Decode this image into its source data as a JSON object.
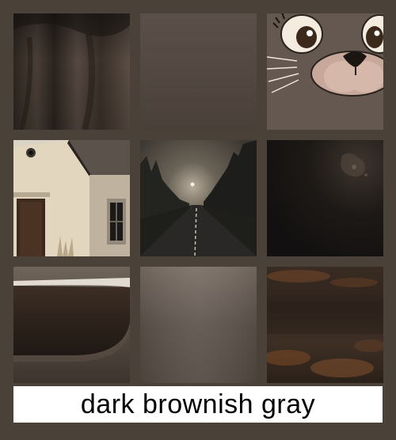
{
  "caption": "dark brownish gray",
  "colors": {
    "background": "#4a4139",
    "caption_background": "#ffffff",
    "caption_text": "#000000"
  },
  "tiles": [
    {
      "name": "dark draped fabric"
    },
    {
      "name": "plain dark brownish gray gradient"
    },
    {
      "name": "cartoon cat face"
    },
    {
      "name": "old house with wooden door"
    },
    {
      "name": "foggy road through dark forest"
    },
    {
      "name": "dark textured wall"
    },
    {
      "name": "dark coffee cup close-up"
    },
    {
      "name": "smooth gray-brown gradient"
    },
    {
      "name": "dark rusty brown texture"
    }
  ]
}
